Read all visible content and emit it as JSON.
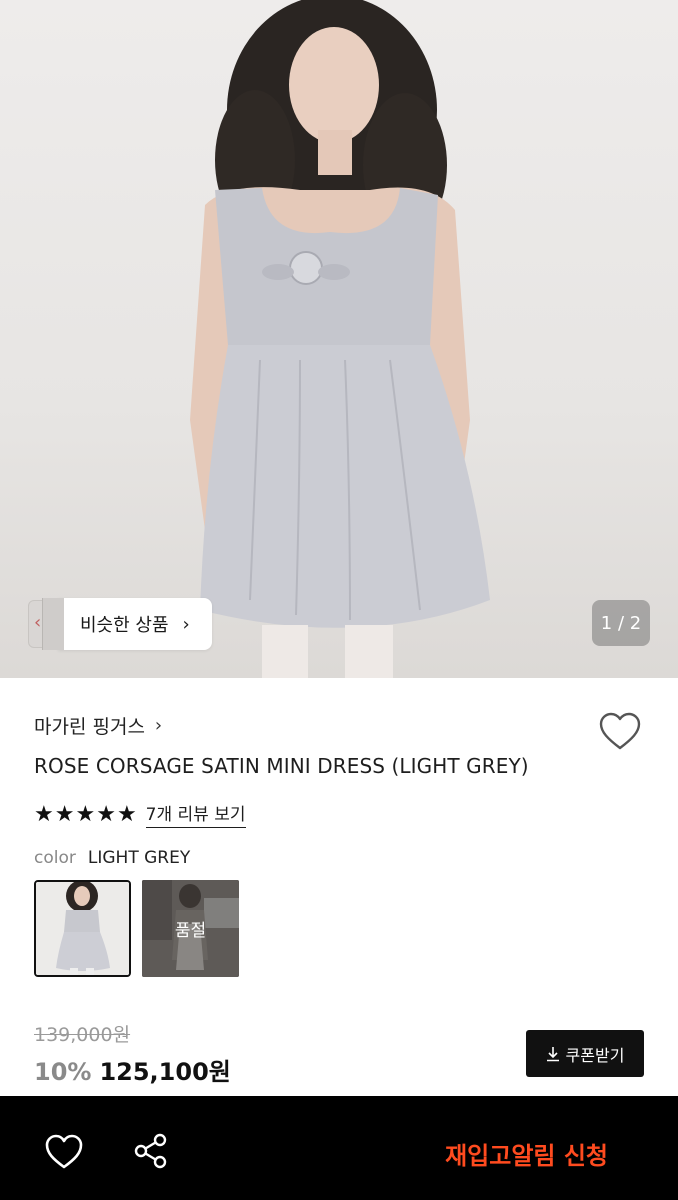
{
  "hero": {
    "similar_label": "비슷한 상품",
    "page_indicator": "1 / 2"
  },
  "product": {
    "brand": "마가린 핑거스",
    "title": "ROSE CORSAGE SATIN MINI DRESS (LIGHT GREY)",
    "rating_stars": 5,
    "review_link": "7개 리뷰 보기",
    "color_label": "color",
    "color_value": "LIGHT GREY",
    "swatches": [
      {
        "name": "light-grey",
        "selected": true
      },
      {
        "name": "other",
        "sold_out_label": "품절"
      }
    ],
    "original_price": "139,000원",
    "discount": "10%",
    "price": "125,100원",
    "coupon_label": "쿠폰받기"
  },
  "bottom_bar": {
    "restock_label": "재입고알림 신청"
  },
  "colors": {
    "accent": "#ff4b1f",
    "bar": "#000000"
  }
}
